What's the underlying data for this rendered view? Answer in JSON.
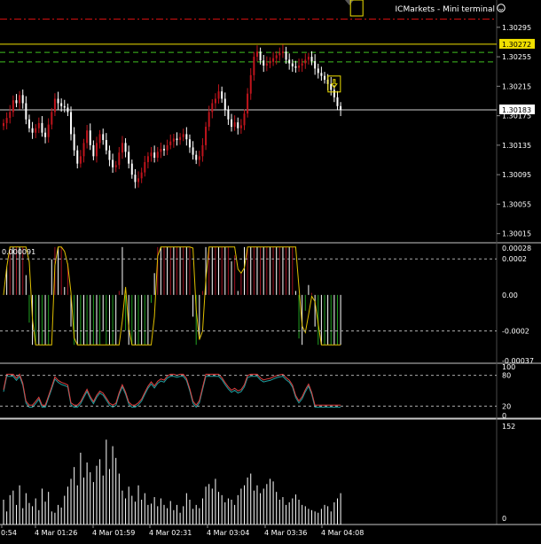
{
  "window": {
    "title": "ICMarkets - Mini terminal",
    "smiley_icon": "smiley-icon"
  },
  "colors": {
    "background": "#000000",
    "bull_candle": "#c0141c",
    "bear_candle": "#ffffff",
    "axis_text": "#ffffff",
    "separator": "#c8c8c8",
    "red_dashdot": "#e01010",
    "yellow_line": "#f0e000",
    "green_dash": "#40c020",
    "macd_pos": "#a01020",
    "macd_neg": "#20a020",
    "macd_signal": "#e0c000",
    "stoch_main": "#e04040",
    "stoch_signal": "#20a0a0",
    "volume": "#ffffff"
  },
  "main_panel": {
    "price_labels": [
      "1.30295",
      "1.30255",
      "1.30215",
      "1.30175",
      "1.30135",
      "1.30095",
      "1.30055",
      "1.30015"
    ],
    "yellow_level_label": "1.30272",
    "current_price_label": "1.30183",
    "ylim": [
      1.30005,
      1.3032
    ],
    "levels": {
      "red_dashdot": 1.30306,
      "yellow": 1.30272,
      "green_upper": 1.30261,
      "green_lower": 1.30248,
      "current": 1.30183
    },
    "markers": [
      {
        "type": "sell-arrow-icon",
        "bar": 103
      },
      {
        "type": "buy-arrow-icon",
        "bar": 110
      }
    ]
  },
  "macd_panel": {
    "label_left": "0.000091",
    "labels": [
      "0.00028",
      "0.0002",
      "0.00",
      "-0.0002",
      "-0.00037"
    ],
    "ylim": [
      -0.00037,
      0.00028
    ]
  },
  "stoch_panel": {
    "labels": [
      "100",
      "80",
      "20",
      "0"
    ],
    "ylim": [
      0,
      100
    ]
  },
  "volume_panel": {
    "labels": [
      "152",
      "0"
    ],
    "ylim": [
      0,
      152
    ]
  },
  "time_axis": {
    "labels": [
      "0:54",
      "4 Mar 01:26",
      "4 Mar 01:59",
      "4 Mar 02:31",
      "4 Mar 03:04",
      "4 Mar 03:36",
      "4 Mar 04:08"
    ]
  },
  "chart_data": {
    "type": "candlestick",
    "symbol_window": "ICMarkets - Mini terminal",
    "close": [
      1.30165,
      1.30172,
      1.3018,
      1.30196,
      1.30192,
      1.30203,
      1.30192,
      1.3017,
      1.30158,
      1.30152,
      1.30158,
      1.30165,
      1.30152,
      1.30146,
      1.30163,
      1.3018,
      1.30198,
      1.30192,
      1.30188,
      1.30186,
      1.3018,
      1.3015,
      1.30128,
      1.3011,
      1.3012,
      1.30138,
      1.30155,
      1.30135,
      1.3012,
      1.30138,
      1.3015,
      1.30142,
      1.30128,
      1.30115,
      1.30105,
      1.30108,
      1.30125,
      1.30138,
      1.30126,
      1.3011,
      1.30095,
      1.30085,
      1.3009,
      1.30098,
      1.30112,
      1.3012,
      1.30125,
      1.30118,
      1.30126,
      1.3013,
      1.30128,
      1.30135,
      1.3014,
      1.30144,
      1.30142,
      1.30146,
      1.3015,
      1.30143,
      1.30132,
      1.30122,
      1.30115,
      1.3012,
      1.30135,
      1.3016,
      1.3018,
      1.30192,
      1.30198,
      1.30208,
      1.30198,
      1.30183,
      1.3017,
      1.3016,
      1.30166,
      1.30158,
      1.30162,
      1.30178,
      1.30205,
      1.3023,
      1.30255,
      1.30262,
      1.3025,
      1.30243,
      1.30246,
      1.30248,
      1.30253,
      1.30257,
      1.3026,
      1.30262,
      1.30251,
      1.30246,
      1.30242,
      1.3024,
      1.30243,
      1.30246,
      1.30251,
      1.30255,
      1.30249,
      1.30239,
      1.30233,
      1.30229,
      1.30224,
      1.30218,
      1.3021,
      1.302,
      1.30188,
      1.30183
    ],
    "volume": [
      38,
      20,
      45,
      52,
      30,
      60,
      25,
      48,
      33,
      28,
      40,
      22,
      55,
      35,
      50,
      20,
      18,
      30,
      26,
      44,
      58,
      70,
      88,
      60,
      110,
      72,
      95,
      80,
      65,
      90,
      100,
      75,
      130,
      85,
      120,
      102,
      78,
      52,
      40,
      58,
      44,
      35,
      60,
      38,
      48,
      30,
      32,
      42,
      28,
      40,
      30,
      25,
      36,
      22,
      30,
      18,
      28,
      48,
      38,
      24,
      30,
      25,
      40,
      58,
      62,
      55,
      70,
      50,
      45,
      34,
      40,
      38,
      30,
      45,
      55,
      60,
      72,
      78,
      52,
      60,
      48,
      55,
      62,
      70,
      66,
      50,
      38,
      42,
      30,
      34,
      40,
      46,
      38,
      30,
      28,
      24,
      22,
      20,
      18,
      24,
      30,
      28,
      20,
      34,
      40,
      48,
      58
    ]
  }
}
